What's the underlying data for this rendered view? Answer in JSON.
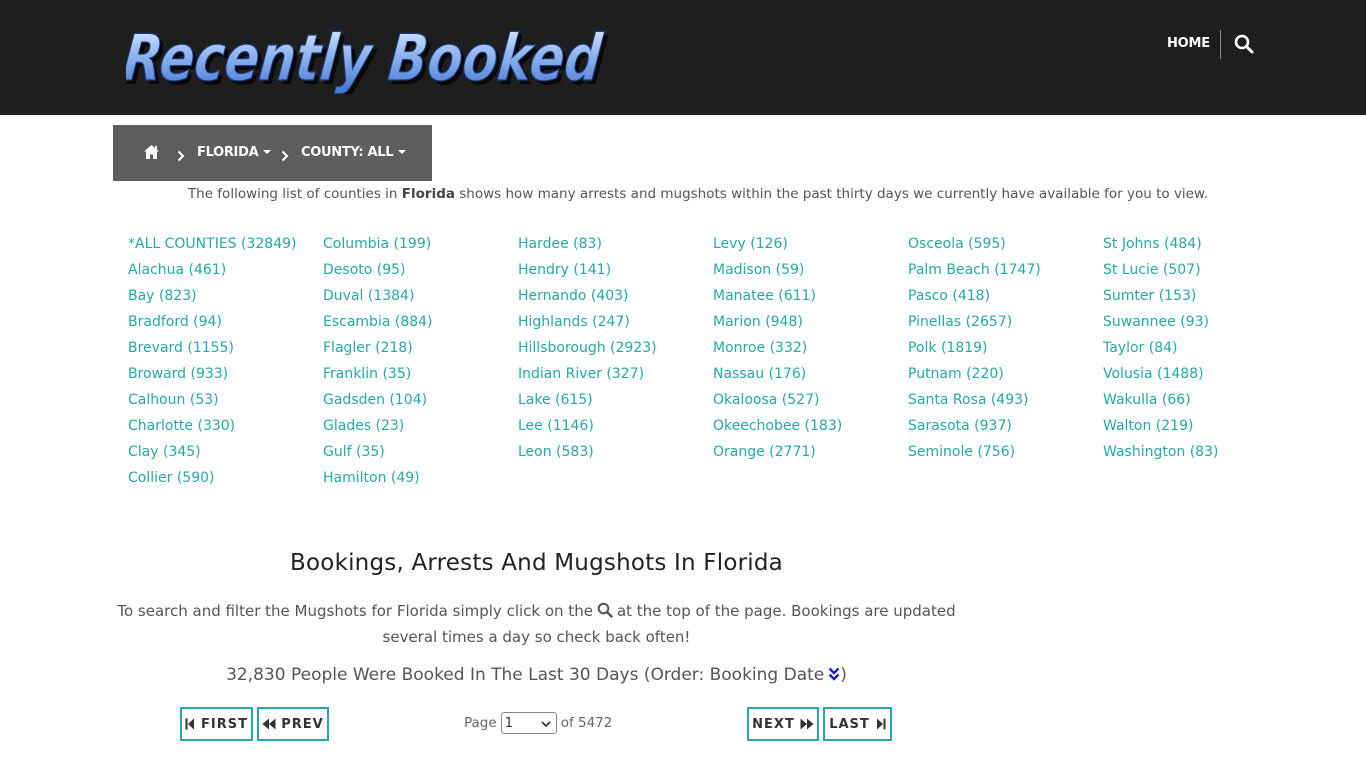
{
  "header": {
    "logo_text": "Recently Booked",
    "nav_home": "HOME"
  },
  "breadcrumb": {
    "state": "FLORIDA",
    "county": "COUNTY: ALL"
  },
  "intro": {
    "before": "The following list of counties in ",
    "state": "Florida",
    "after": " shows how many arrests and mugshots within the past thirty days we currently have available for you to view."
  },
  "counties": [
    [
      "*ALL COUNTIES (32849)",
      "Alachua (461)",
      "Bay (823)",
      "Bradford (94)",
      "Brevard (1155)",
      "Broward (933)",
      "Calhoun (53)",
      "Charlotte (330)",
      "Clay (345)",
      "Collier (590)"
    ],
    [
      "Columbia (199)",
      "Desoto (95)",
      "Duval (1384)",
      "Escambia (884)",
      "Flagler (218)",
      "Franklin (35)",
      "Gadsden (104)",
      "Glades (23)",
      "Gulf (35)",
      "Hamilton (49)"
    ],
    [
      "Hardee (83)",
      "Hendry (141)",
      "Hernando (403)",
      "Highlands (247)",
      "Hillsborough (2923)",
      "Indian River (327)",
      "Lake (615)",
      "Lee (1146)",
      "Leon (583)"
    ],
    [
      "Levy (126)",
      "Madison (59)",
      "Manatee (611)",
      "Marion (948)",
      "Monroe (332)",
      "Nassau (176)",
      "Okaloosa (527)",
      "Okeechobee (183)",
      "Orange (2771)"
    ],
    [
      "Osceola (595)",
      "Palm Beach (1747)",
      "Pasco (418)",
      "Pinellas (2657)",
      "Polk (1819)",
      "Putnam (220)",
      "Santa Rosa (493)",
      "Sarasota (937)",
      "Seminole (756)"
    ],
    [
      "St Johns (484)",
      "St Lucie (507)",
      "Sumter (153)",
      "Suwannee (93)",
      "Taylor (84)",
      "Volusia (1488)",
      "Wakulla (66)",
      "Walton (219)",
      "Washington (83)"
    ]
  ],
  "section": {
    "title": "Bookings, Arrests And Mugshots In Florida",
    "desc_before": "To search and filter the Mugshots for Florida simply click on the",
    "desc_after": "at the top of the page. Bookings are updated several times a day so check back often!",
    "count_text": "32,830 People Were Booked In The Last 30 Days (Order: Booking Date",
    "count_close": ")"
  },
  "pagination": {
    "first": "FIRST",
    "prev": "PREV",
    "next": "NEXT",
    "last": "LAST",
    "page_label": "Page",
    "page_value": "1",
    "of_label": "of 5472"
  },
  "colors": {
    "header_bg": "#1e1e1e",
    "accent": "#26a8a6",
    "breadcrumb_bg": "#5e5e5e"
  },
  "icons": {
    "search": "search-icon",
    "home": "home-icon",
    "chevron": "chevron-right-icon",
    "order": "double-chevron-down-icon"
  }
}
